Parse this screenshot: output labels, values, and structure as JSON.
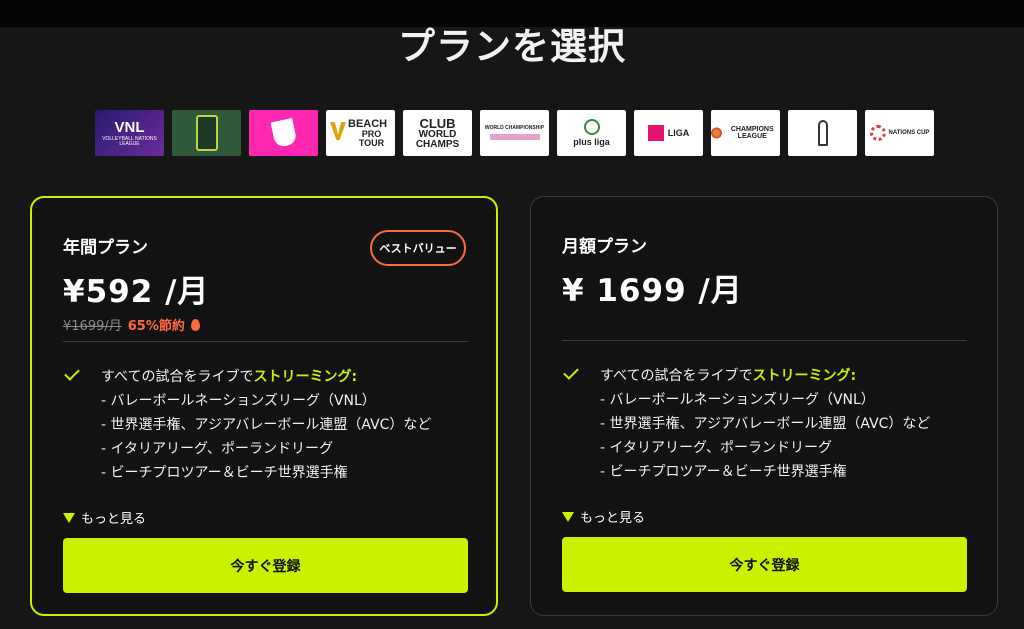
{
  "header": {
    "title": "プランを選択"
  },
  "logos": [
    {
      "name": "VNL",
      "text": "VNL",
      "sub": "VOLLEYBALL NATIONS LEAGUE"
    },
    {
      "name": "app",
      "text": ""
    },
    {
      "name": "pink",
      "text": ""
    },
    {
      "name": "beach-pro-tour",
      "text": "BEACH",
      "sub": "PRO TOUR"
    },
    {
      "name": "club-world-champs",
      "text": "CLUB",
      "sub": "WORLD CHAMPS"
    },
    {
      "name": "world-championship",
      "text": "WORLD CHAMPIONSHIP"
    },
    {
      "name": "plus-liga",
      "text": "plus liga"
    },
    {
      "name": "liga",
      "text": "LIGA"
    },
    {
      "name": "champions-league",
      "text": "CHAMPIONS LEAGUE"
    },
    {
      "name": "trophy",
      "text": ""
    },
    {
      "name": "nations-cup",
      "text": "NATIONS CUP"
    }
  ],
  "plans": {
    "annual": {
      "name": "年間プラン",
      "badge": "ベストバリュー",
      "price": "¥592 /月",
      "old_price": "¥1699/月",
      "saving": "65%節約",
      "feature_intro": "すべての試合をライブで",
      "feature_highlight": "ストリーミング:",
      "features": [
        "- バレーボールネーションズリーグ（VNL）",
        "- 世界選手権、アジアバレーボール連盟（AVC）など",
        "- イタリアリーグ、ポーランドリーグ",
        "- ビーチプロツアー＆ビーチ世界選手権"
      ],
      "more": "もっと見る",
      "cta": "今すぐ登録"
    },
    "monthly": {
      "name": "月額プラン",
      "price": "¥ 1699 /月",
      "feature_intro": "すべての試合をライブで",
      "feature_highlight": "ストリーミング:",
      "features": [
        "- バレーボールネーションズリーグ（VNL）",
        "- 世界選手権、アジアバレーボール連盟（AVC）など",
        "- イタリアリーグ、ポーランドリーグ",
        "- ビーチプロツアー＆ビーチ世界選手権"
      ],
      "more": "もっと見る",
      "cta": "今すぐ登録"
    }
  },
  "colors": {
    "accent": "#c9f200",
    "badge": "#ff6a3d",
    "background": "#161616"
  }
}
